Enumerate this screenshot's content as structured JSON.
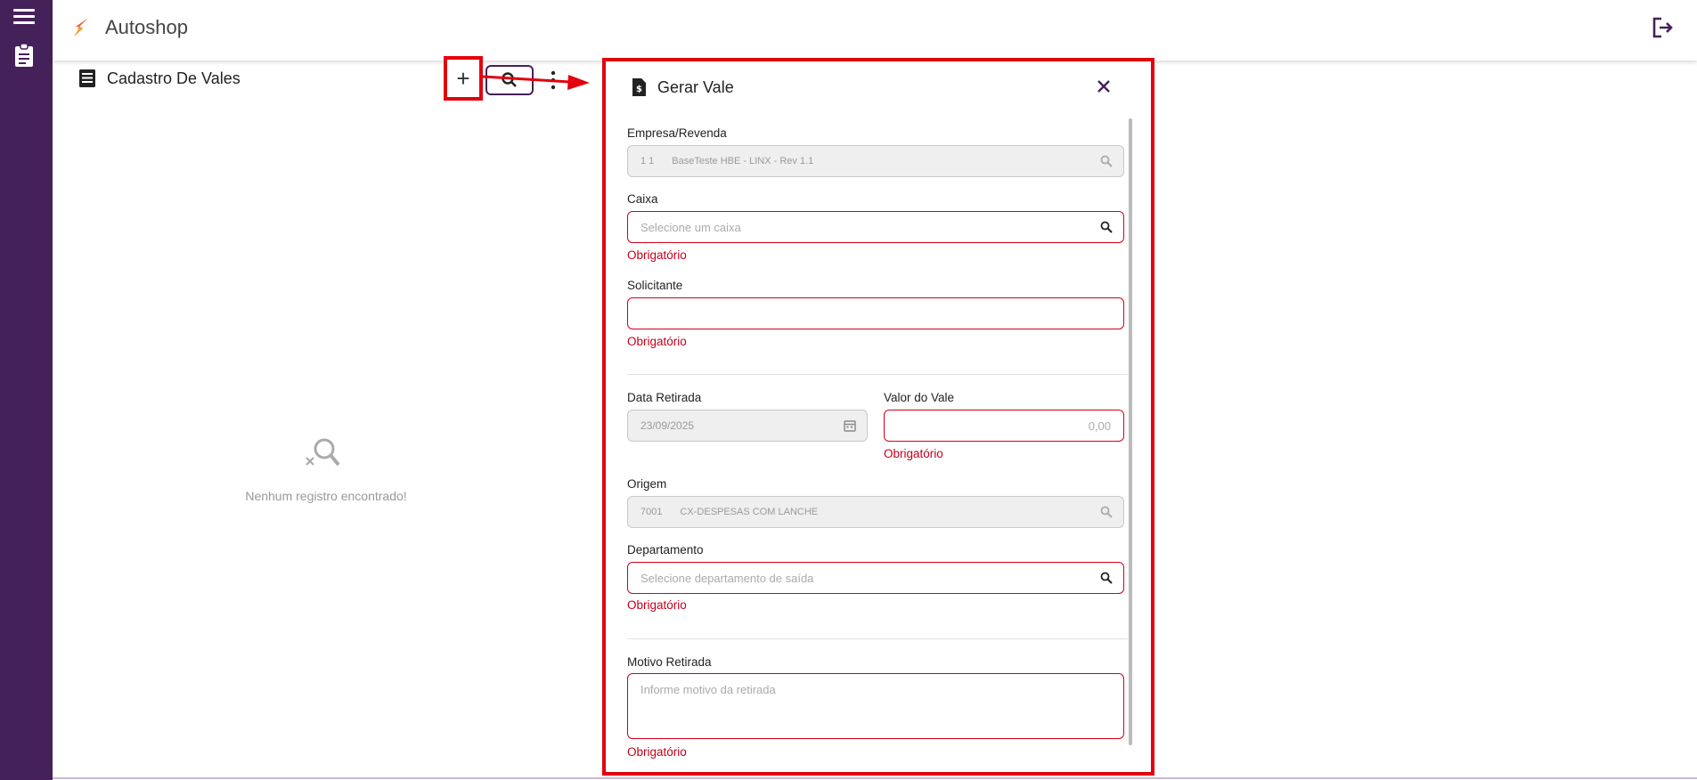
{
  "app": {
    "title": "Autoshop"
  },
  "page": {
    "title": "Cadastro De Vales",
    "empty_text": "Nenhum registro encontrado!"
  },
  "toolbar": {
    "add_label": "+"
  },
  "modal": {
    "title": "Gerar Vale",
    "fields": {
      "empresa": {
        "label": "Empresa/Revenda",
        "code": "1 1",
        "value": "BaseTeste HBE - LINX - Rev 1.1"
      },
      "caixa": {
        "label": "Caixa",
        "placeholder": "Selecione um caixa",
        "error": "Obrigatório"
      },
      "solicitante": {
        "label": "Solicitante",
        "value": "",
        "error": "Obrigatório"
      },
      "data_retirada": {
        "label": "Data Retirada",
        "value": "23/09/2025"
      },
      "valor_vale": {
        "label": "Valor do Vale",
        "placeholder": "0,00",
        "error": "Obrigatório"
      },
      "origem": {
        "label": "Origem",
        "code": "7001",
        "value": "CX-DESPESAS COM LANCHE"
      },
      "departamento": {
        "label": "Departamento",
        "placeholder": "Selecione departamento de saída",
        "error": "Obrigatório"
      },
      "motivo": {
        "label": "Motivo Retirada",
        "placeholder": "Informe motivo da retirada",
        "error": "Obrigatório"
      }
    }
  },
  "colors": {
    "sidebar": "#452159",
    "highlight": "#e3000f",
    "error": "#c4001b"
  }
}
